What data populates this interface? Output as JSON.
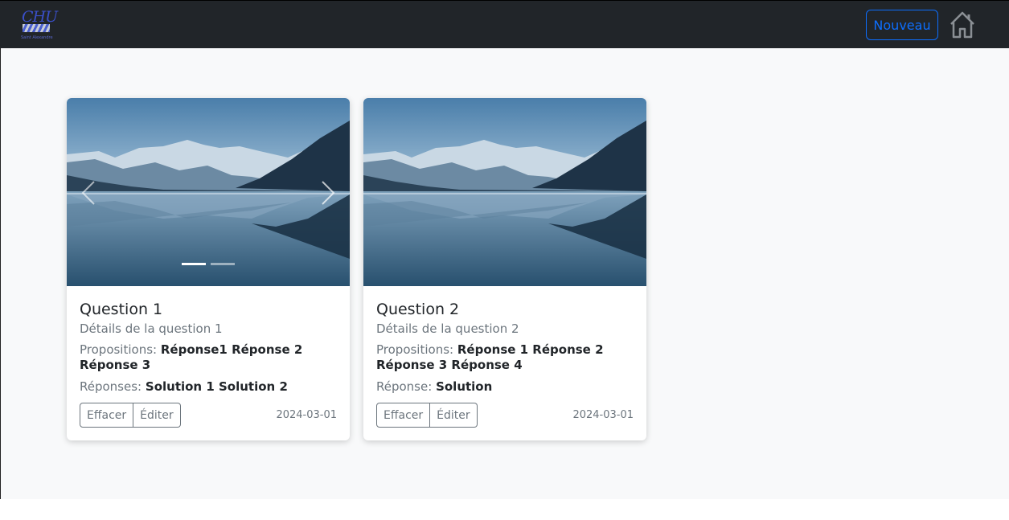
{
  "navbar": {
    "logo_text": "CHU",
    "logo_subtext": "Saint Alexandre",
    "new_button": "Nouveau"
  },
  "cards": [
    {
      "title": "Question 1",
      "subtitle": "Détails de la question 1",
      "propositions_label": "Propositions:",
      "propositions_value": "Réponse1 Réponse 2 Réponse 3",
      "answers_label": "Réponses:",
      "answers_value": "Solution 1 Solution 2",
      "delete_label": "Effacer",
      "edit_label": "Éditer",
      "date": "2024-03-01",
      "carousel": {
        "slides": 2,
        "active": 1
      }
    },
    {
      "title": "Question 2",
      "subtitle": "Détails de la question 2",
      "propositions_label": "Propositions:",
      "propositions_value": "Réponse 1 Réponse 2 Réponse 3 Réponse 4",
      "answers_label": "Réponse:",
      "answers_value": "Solution",
      "delete_label": "Effacer",
      "edit_label": "Éditer",
      "date": "2024-03-01"
    }
  ],
  "colors": {
    "navbar": "#212529",
    "accent": "#0d6efd",
    "page_bg": "#f8f9fa",
    "muted": "#6c757d"
  },
  "icons": {
    "home": "home-icon",
    "prev": "chevron-left-icon",
    "next": "chevron-right-icon"
  }
}
